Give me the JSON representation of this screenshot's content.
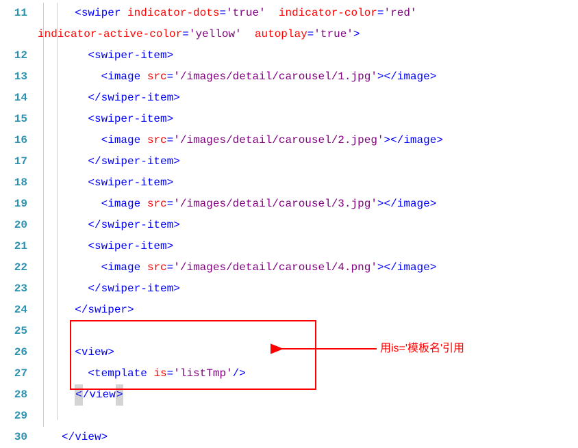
{
  "lines": [
    {
      "num": "11"
    },
    {
      "num": "12"
    },
    {
      "num": "13"
    },
    {
      "num": "14"
    },
    {
      "num": "15"
    },
    {
      "num": "16"
    },
    {
      "num": "17"
    },
    {
      "num": "18"
    },
    {
      "num": "19"
    },
    {
      "num": "20"
    },
    {
      "num": "21"
    },
    {
      "num": "22"
    },
    {
      "num": "23"
    },
    {
      "num": "24"
    },
    {
      "num": "25"
    },
    {
      "num": "26"
    },
    {
      "num": "27"
    },
    {
      "num": "28"
    },
    {
      "num": "29"
    },
    {
      "num": "30"
    }
  ],
  "code": {
    "l11_tag": "swiper",
    "l11_attr1": "indicator-dots",
    "l11_val1": "'true'",
    "l11_attr2": "indicator-color",
    "l11_val2": "'red'",
    "l11w_attr1": "indicator-active-color",
    "l11w_val1": "'yellow'",
    "l11w_attr2": "autoplay",
    "l11w_val2": "'true'",
    "l12_tag": "swiper-item",
    "l13_tag": "image",
    "l13_attr": "src",
    "l13_val": "'/images/detail/carousel/1.jpg'",
    "l14_tag": "swiper-item",
    "l15_tag": "swiper-item",
    "l16_tag": "image",
    "l16_attr": "src",
    "l16_val": "'/images/detail/carousel/2.jpeg'",
    "l17_tag": "swiper-item",
    "l18_tag": "swiper-item",
    "l19_tag": "image",
    "l19_attr": "src",
    "l19_val": "'/images/detail/carousel/3.jpg'",
    "l20_tag": "swiper-item",
    "l21_tag": "swiper-item",
    "l22_tag": "image",
    "l22_attr": "src",
    "l22_val": "'/images/detail/carousel/4.png'",
    "l23_tag": "swiper-item",
    "l24_tag": "swiper",
    "l26_tag": "view",
    "l27_tag": "template",
    "l27_attr": "is",
    "l27_val": "'listTmp'",
    "l28_tag": "view",
    "l30_tag": "view"
  },
  "annotation": {
    "text": "用is='模板名'引用"
  }
}
